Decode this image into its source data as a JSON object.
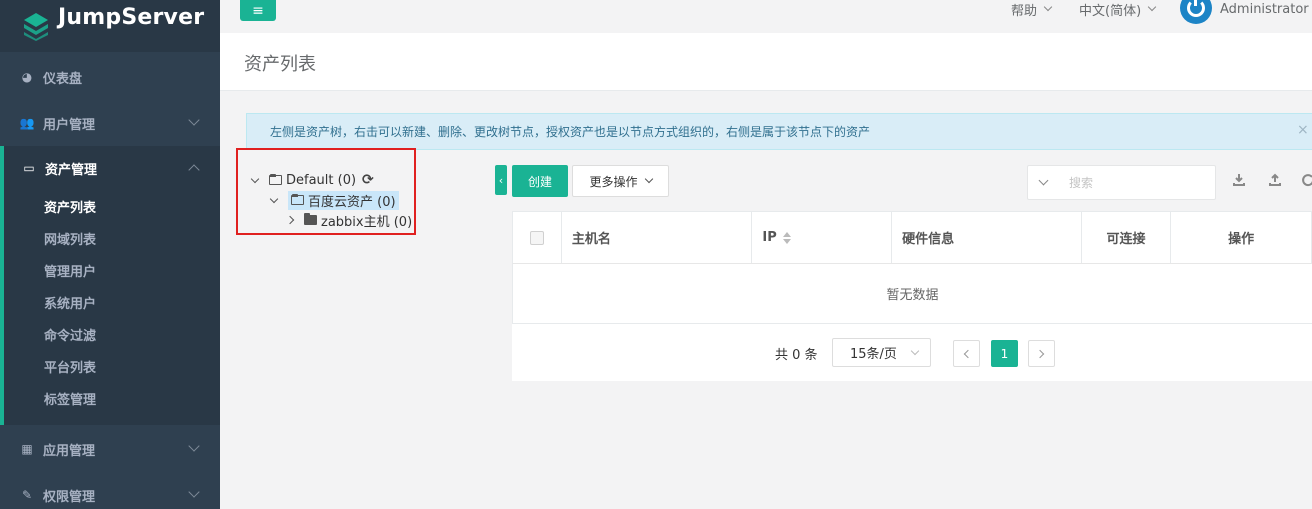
{
  "app": {
    "name": "JumpServer"
  },
  "sidebar": {
    "items": [
      {
        "label": "仪表盘",
        "icon": "dashboard-icon"
      },
      {
        "label": "用户管理",
        "icon": "users-icon"
      },
      {
        "label": "资产管理",
        "icon": "inbox-icon"
      },
      {
        "label": "应用管理",
        "icon": "grid-icon"
      },
      {
        "label": "权限管理",
        "icon": "edit-icon"
      }
    ],
    "asset_submenu": [
      "资产列表",
      "网域列表",
      "管理用户",
      "系统用户",
      "命令过滤",
      "平台列表",
      "标签管理"
    ]
  },
  "topbar": {
    "help": "帮助",
    "language": "中文(简体)",
    "user": "Administrator",
    "menu_icon": "≡"
  },
  "page": {
    "title": "资产列表"
  },
  "alert": {
    "text": "左侧是资产树，右击可以新建、删除、更改树节点，授权资产也是以节点方式组织的，右侧是属于该节点下的资产",
    "close": "×"
  },
  "tree": {
    "root": "Default (0)",
    "child": "百度云资产 (0)",
    "grandchild": "zabbix主机 (0)",
    "refresh_icon": "⟳"
  },
  "toolbar": {
    "create": "创建",
    "more": "更多操作",
    "search_placeholder": "搜索",
    "collapse": "‹"
  },
  "table": {
    "columns": [
      "主机名",
      "IP",
      "硬件信息",
      "可连接",
      "操作"
    ],
    "empty": "暂无数据"
  },
  "pagination": {
    "total": "共 0 条",
    "page_size": "15条/页",
    "current_page": "1"
  },
  "colors": {
    "sidebar": "#2f4050",
    "accent": "#1ab394",
    "alert_bg": "#d9edf7",
    "tree_selected": "#c9e6f9",
    "user_icon": "#1c84c6",
    "highlight_border": "#e02020"
  }
}
